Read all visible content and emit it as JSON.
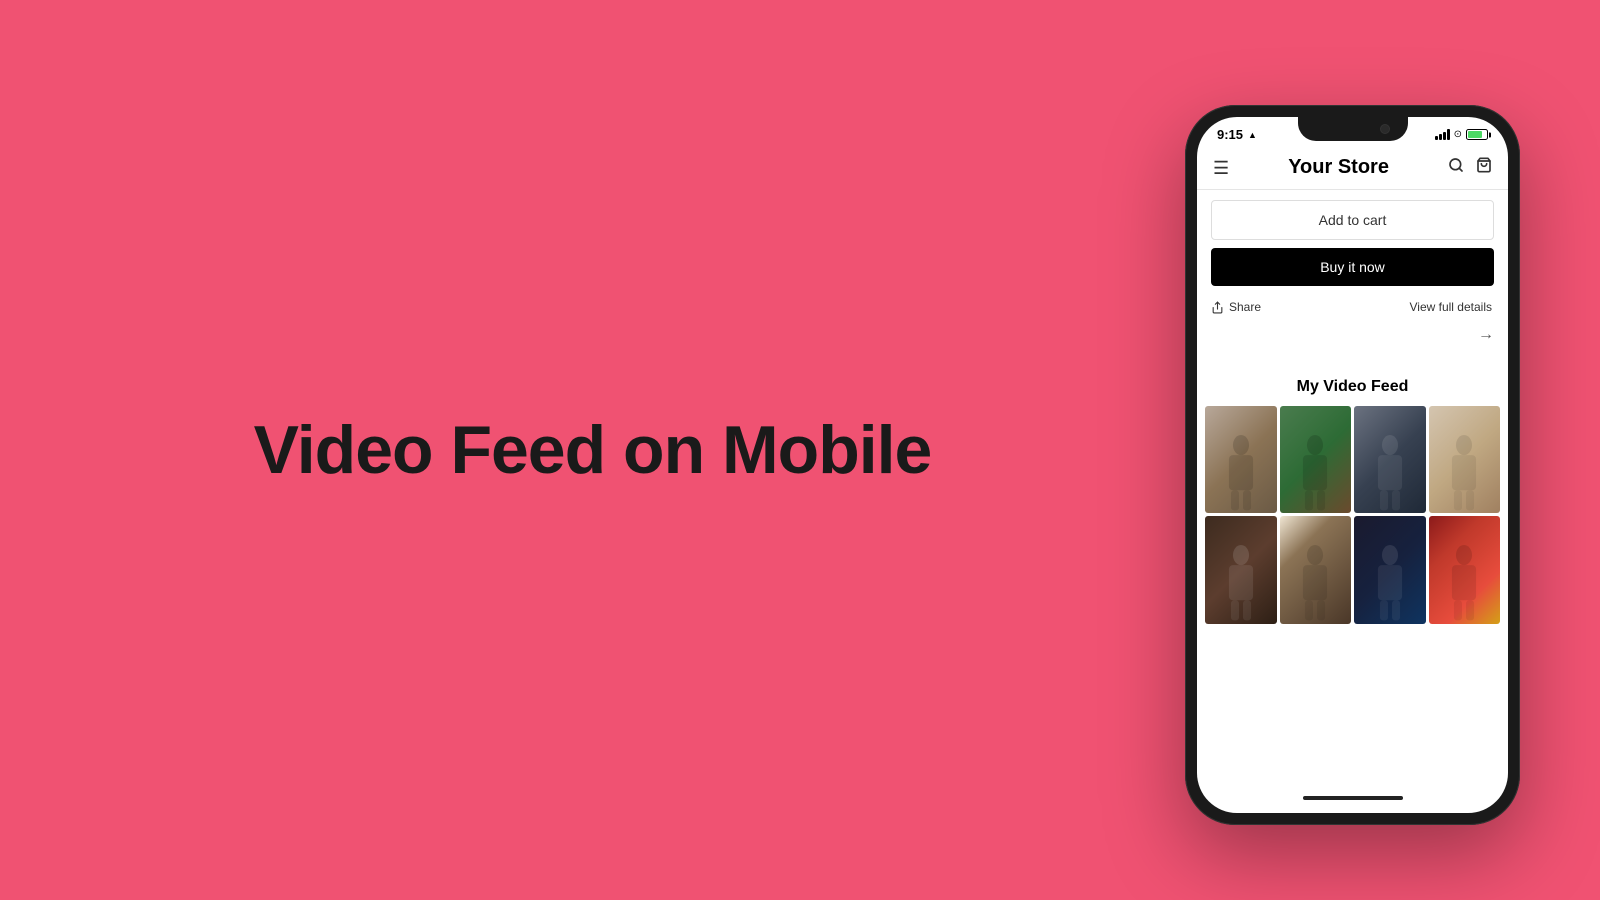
{
  "background": {
    "color": "#f05272"
  },
  "left_section": {
    "heading": "Video Feed on Mobile"
  },
  "phone": {
    "status_bar": {
      "time": "9:15",
      "location_arrow": "▲"
    },
    "header": {
      "store_name": "Your Store",
      "menu_icon": "☰",
      "search_icon": "🔍",
      "cart_icon": "🛍"
    },
    "buttons": {
      "add_to_cart": "Add to cart",
      "buy_it_now": "Buy it now"
    },
    "product_actions": {
      "share_label": "Share",
      "view_full_label": "View full details"
    },
    "video_feed": {
      "title": "My Video Feed",
      "thumbnails": [
        {
          "id": 1,
          "class": "thumb-1",
          "alt": "fashion-model-1"
        },
        {
          "id": 2,
          "class": "thumb-2",
          "alt": "fashion-model-2"
        },
        {
          "id": 3,
          "class": "thumb-3",
          "alt": "fashion-model-3"
        },
        {
          "id": 4,
          "class": "thumb-4",
          "alt": "fashion-model-4"
        },
        {
          "id": 5,
          "class": "thumb-5",
          "alt": "fashion-model-5"
        },
        {
          "id": 6,
          "class": "thumb-6",
          "alt": "fashion-model-6"
        },
        {
          "id": 7,
          "class": "thumb-7",
          "alt": "fashion-model-7"
        },
        {
          "id": 8,
          "class": "thumb-8",
          "alt": "fashion-model-8"
        }
      ]
    }
  }
}
